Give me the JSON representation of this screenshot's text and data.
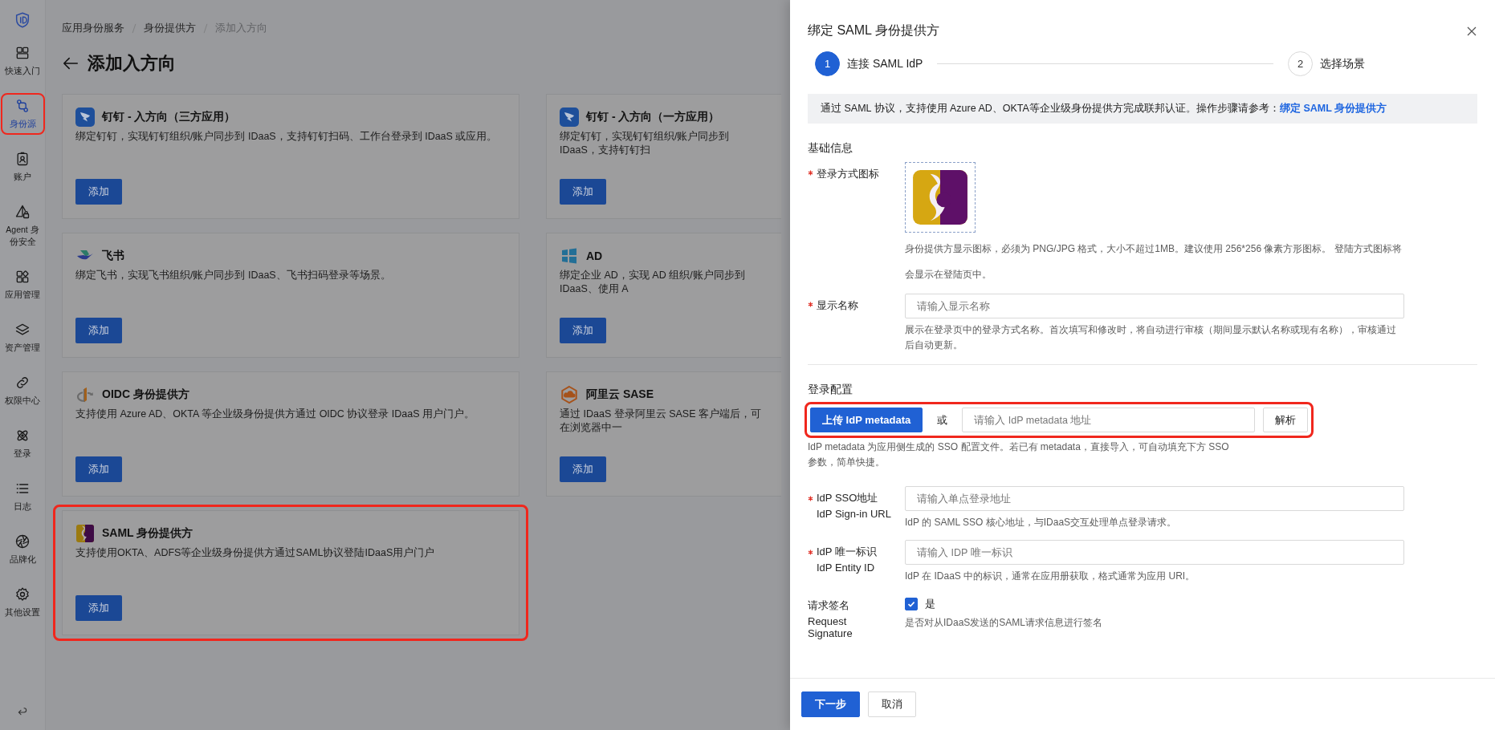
{
  "sidebar": {
    "items": [
      {
        "label": "快速入门",
        "selected": false,
        "highlighted": false
      },
      {
        "label": "身份源",
        "selected": true,
        "highlighted": true
      },
      {
        "label": "账户",
        "selected": false,
        "highlighted": false
      },
      {
        "label": "Agent 身份安全",
        "selected": false,
        "highlighted": false
      },
      {
        "label": "应用管理",
        "selected": false,
        "highlighted": false
      },
      {
        "label": "资产管理",
        "selected": false,
        "highlighted": false
      },
      {
        "label": "权限中心",
        "selected": false,
        "highlighted": false
      },
      {
        "label": "登录",
        "selected": false,
        "highlighted": false
      },
      {
        "label": "日志",
        "selected": false,
        "highlighted": false
      },
      {
        "label": "品牌化",
        "selected": false,
        "highlighted": false
      },
      {
        "label": "其他设置",
        "selected": false,
        "highlighted": false
      }
    ]
  },
  "breadcrumb": [
    {
      "label": "应用身份服务",
      "current": false
    },
    {
      "label": "身份提供方",
      "current": false
    },
    {
      "label": "添加入方向",
      "current": true
    }
  ],
  "page_title": "添加入方向",
  "cards": [
    {
      "title": "钉钉 - 入方向（三方应用）",
      "description": "绑定钉钉，实现钉钉组织/账户同步到 IDaaS，支持钉钉扫码、工作台登录到 IDaaS 或应用。",
      "button": "添加",
      "highlighted": false
    },
    {
      "title": "钉钉 - 入方向（一方应用）",
      "description": "绑定钉钉，实现钉钉组织/账户同步到 IDaaS，支持钉钉扫",
      "button": "添加",
      "highlighted": false
    },
    {
      "title": "飞书",
      "description": "绑定飞书，实现飞书组织/账户同步到 IDaaS、飞书扫码登录等场景。",
      "button": "添加",
      "highlighted": false
    },
    {
      "title": "AD",
      "description": "绑定企业 AD，实现 AD 组织/账户同步到 IDaaS、使用 A",
      "button": "添加",
      "highlighted": false
    },
    {
      "title": "OIDC 身份提供方",
      "description": "支持使用 Azure AD、OKTA 等企业级身份提供方通过 OIDC 协议登录 IDaaS 用户门户。",
      "button": "添加",
      "highlighted": false
    },
    {
      "title": "阿里云 SASE",
      "description": "通过 IDaaS 登录阿里云 SASE 客户端后，可在浏览器中一",
      "button": "添加",
      "highlighted": false
    },
    {
      "title": "SAML 身份提供方",
      "description": "支持使用OKTA、ADFS等企业级身份提供方通过SAML协议登陆IDaaS用户门户",
      "button": "添加",
      "highlighted": true
    }
  ],
  "drawer": {
    "title": "绑定 SAML 身份提供方",
    "steps": [
      {
        "number": "1",
        "label": "连接 SAML IdP",
        "selected": true
      },
      {
        "number": "2",
        "label": "选择场景",
        "selected": false
      }
    ],
    "notice": {
      "text": "通过 SAML 协议，支持使用 Azure AD、OKTA等企业级身份提供方完成联邦认证。操作步骤请参考：",
      "link": "绑定 SAML 身份提供方"
    },
    "basic": {
      "heading": "基础信息",
      "icon_field": {
        "label": "登录方式图标",
        "required": true,
        "help": "身份提供方显示图标，必须为 PNG/JPG 格式，大小不超过1MB。建议使用 256*256 像素方形图标。 登陆方式图标将会显示在登陆页中。"
      },
      "name_field": {
        "label": "显示名称",
        "required": true,
        "placeholder": "请输入显示名称",
        "help": "展示在登录页中的登录方式名称。首次填写和修改时，将自动进行审核（期间显示默认名称或现有名称），审核通过后自动更新。"
      }
    },
    "login_config": {
      "heading": "登录配置",
      "highlighted": true,
      "upload_button": "上传 IdP metadata",
      "or": "或",
      "url_placeholder": "请输入 IdP metadata 地址",
      "parse_button": "解析",
      "help": "IdP metadata 为应用侧生成的 SSO 配置文件。若已有 metadata，直接导入，可自动填充下方 SSO 参数，简单快捷。"
    },
    "fields": [
      {
        "kind": "input",
        "label": "IdP SSO地址",
        "sublabel": "IdP Sign-in URL",
        "required": true,
        "placeholder": "请输入单点登录地址",
        "help": "IdP 的 SAML SSO 核心地址，与IDaaS交互处理单点登录请求。"
      },
      {
        "kind": "input",
        "label": "IdP 唯一标识",
        "sublabel": "IdP Entity ID",
        "required": true,
        "placeholder": "请输入 IDP 唯一标识",
        "help": "IdP 在 IDaaS 中的标识，通常在应用册获取，格式通常为应用 URI。"
      },
      {
        "kind": "checkbox",
        "label": "请求签名",
        "sublabel": "Request Signature",
        "required": false,
        "checked": true,
        "option": "是",
        "help": "是否对从IDaaS发送的SAML请求信息进行签名"
      }
    ],
    "footer": [
      {
        "label": "下一步",
        "kind": "primary"
      },
      {
        "label": "取消",
        "kind": "default"
      }
    ]
  }
}
